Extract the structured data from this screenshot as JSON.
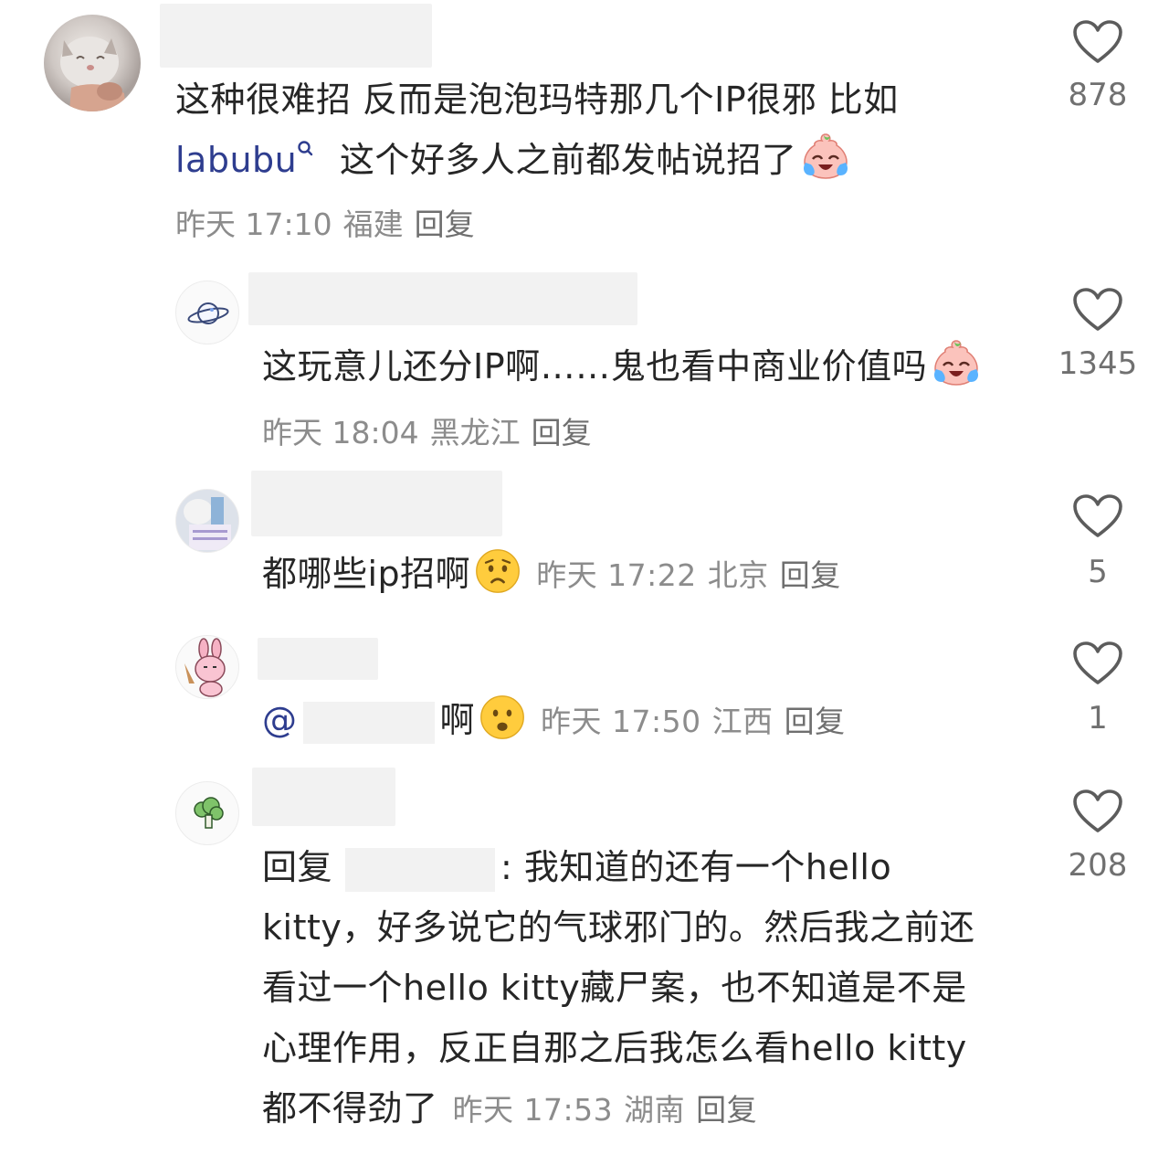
{
  "comments": [
    {
      "text_line1": "这种很难招 反而是泡泡玛特那几个IP很邪 比如",
      "link": "labubu",
      "text_line2": "这个好多人之前都发帖说招了",
      "time": "昨天 17:10",
      "location": "福建",
      "reply_label": "回复",
      "likes": "878"
    },
    {
      "text": "这玩意儿还分IP啊……鬼也看中商业价值吗",
      "time": "昨天 18:04",
      "location": "黑龙江",
      "reply_label": "回复",
      "likes": "1345"
    },
    {
      "text": "都哪些ip招啊",
      "time": "昨天 17:22",
      "location": "北京",
      "reply_label": "回复",
      "likes": "5"
    },
    {
      "at": "@",
      "text": "啊",
      "time": "昨天 17:50",
      "location": "江西",
      "reply_label": "回复",
      "likes": "1"
    },
    {
      "prefix": "回复",
      "line1": ": 我知道的还有一个hello",
      "line2": "kitty，好多说它的气球邪门的。然后我之前还",
      "line3": "看过一个hello kitty藏尸案，也不知道是不是",
      "line4": "心理作用，反正自那之后我怎么看hello kitty",
      "line5": "都不得劲了",
      "time": "昨天 17:53",
      "location": "湖南",
      "reply_label": "回复",
      "likes": "208"
    }
  ],
  "icons": {
    "like": "heart-outline-icon",
    "search_hint": "search-icon",
    "laugh_cry": "laugh-cry-emoji",
    "worried": "worried-emoji",
    "surprised": "surprised-emoji"
  },
  "colors": {
    "text": "#262626",
    "meta": "#8c8c8c",
    "link": "#2e3d8f",
    "mask": "#f2f2f2"
  }
}
